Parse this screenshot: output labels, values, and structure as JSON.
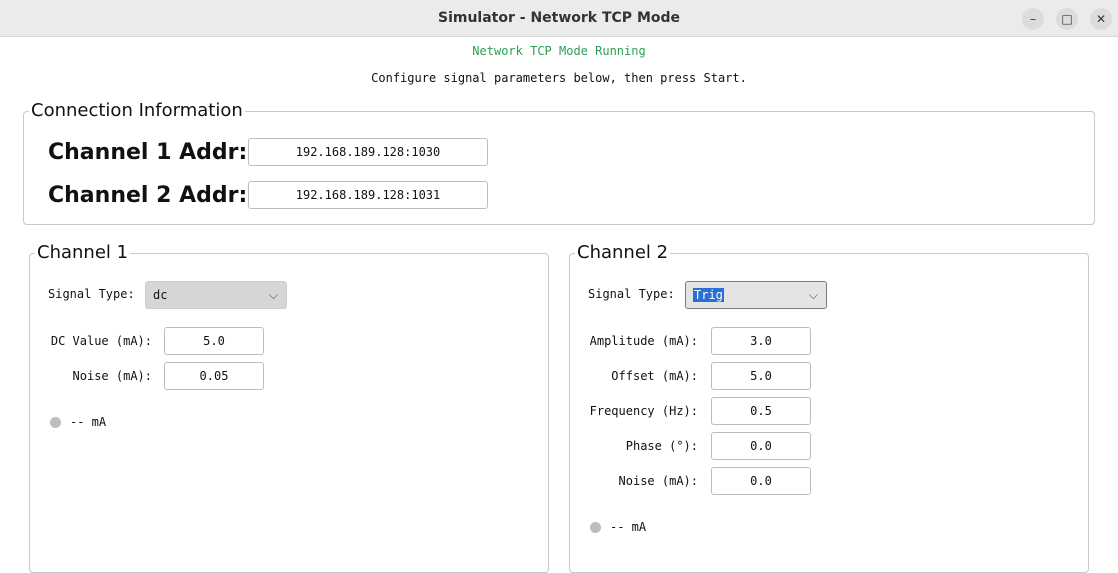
{
  "window": {
    "title": "Simulator - Network TCP Mode",
    "controls": {
      "minimize": "–",
      "maximize": "□",
      "close": "✕"
    }
  },
  "status_text": "Network TCP Mode Running",
  "instructions": "Configure signal parameters below, then press Start.",
  "connection": {
    "title": "Connection Information",
    "ch1_label": "Channel 1 Addr:",
    "ch1_value": "192.168.189.128:1030",
    "ch2_label": "Channel 2 Addr:",
    "ch2_value": "192.168.189.128:1031"
  },
  "channel1": {
    "title": "Channel 1",
    "signal_type_label": "Signal Type:",
    "signal_type_value": "dc",
    "params": [
      {
        "label": "DC Value (mA):",
        "value": "5.0"
      },
      {
        "label": "Noise (mA):",
        "value": "0.05"
      }
    ],
    "readout": "-- mA"
  },
  "channel2": {
    "title": "Channel 2",
    "signal_type_label": "Signal Type:",
    "signal_type_value": "Trig",
    "params": [
      {
        "label": "Amplitude (mA):",
        "value": "3.0"
      },
      {
        "label": "Offset (mA):",
        "value": "5.0"
      },
      {
        "label": "Frequency (Hz):",
        "value": "0.5"
      },
      {
        "label": "Phase (°):",
        "value": "0.0"
      },
      {
        "label": "Noise (mA):",
        "value": "0.0"
      }
    ],
    "readout": "-- mA"
  },
  "colors": {
    "status_green": "#2e9e55",
    "selection_blue": "#2a6fd6",
    "indicator_gray": "#bdbdbd"
  }
}
